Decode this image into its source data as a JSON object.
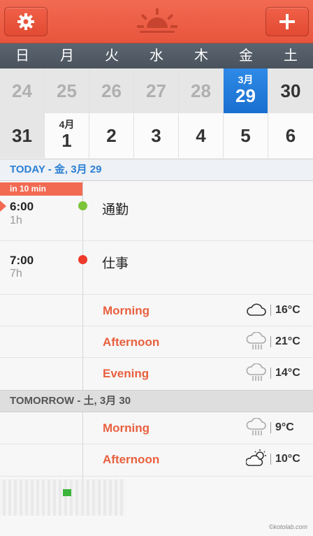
{
  "weekdays": [
    "日",
    "月",
    "火",
    "水",
    "木",
    "金",
    "土"
  ],
  "calendar": {
    "week1": [
      {
        "num": "24",
        "mon": ""
      },
      {
        "num": "25",
        "mon": ""
      },
      {
        "num": "26",
        "mon": ""
      },
      {
        "num": "27",
        "mon": ""
      },
      {
        "num": "28",
        "mon": ""
      },
      {
        "num": "29",
        "mon": "3月"
      },
      {
        "num": "30",
        "mon": ""
      }
    ],
    "week2": [
      {
        "num": "31",
        "mon": ""
      },
      {
        "num": "1",
        "mon": "4月"
      },
      {
        "num": "2",
        "mon": ""
      },
      {
        "num": "3",
        "mon": ""
      },
      {
        "num": "4",
        "mon": ""
      },
      {
        "num": "5",
        "mon": ""
      },
      {
        "num": "6",
        "mon": ""
      }
    ]
  },
  "today_header": "TODAY - 金, 3月 29",
  "tomorrow_header": "TOMORROW - 土, 3月 30",
  "countdown": "in 10 min",
  "events": [
    {
      "time": "6:00",
      "duration": "1h",
      "title": "通勤",
      "color": "#7cc43a"
    },
    {
      "time": "7:00",
      "duration": "7h",
      "title": "仕事",
      "color": "#ee3b2a"
    }
  ],
  "today_weather": [
    {
      "label": "Morning",
      "temp": "16°C",
      "icon": "cloud-icon"
    },
    {
      "label": "Afternoon",
      "temp": "21°C",
      "icon": "rain-icon"
    },
    {
      "label": "Evening",
      "temp": "14°C",
      "icon": "rain-icon"
    }
  ],
  "tomorrow_weather": [
    {
      "label": "Morning",
      "temp": "9°C",
      "icon": "rain-icon"
    },
    {
      "label": "Afternoon",
      "temp": "10°C",
      "icon": "partly-sunny-icon"
    }
  ],
  "credit": "©kotolab.com",
  "colors": {
    "accent": "#e8553d",
    "today_blue": "#1a6fd0",
    "weather_label": "#e8603f"
  }
}
